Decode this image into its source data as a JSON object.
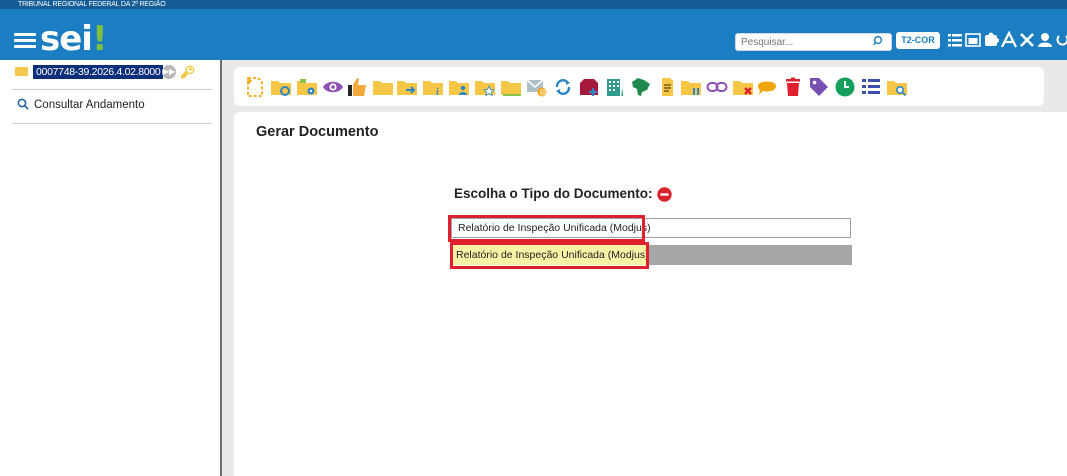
{
  "header": {
    "org_name": "TRIBUNAL REGIONAL FEDERAL DA 2ª REGIÃO",
    "logo_text": "sei",
    "logo_mark": "!",
    "search": {
      "placeholder": "Pesquisar..."
    },
    "unit_badge": "T2-COR",
    "icons": [
      "menu-icon",
      "search-icon",
      "list-icon",
      "calendar-icon",
      "puzzle-icon",
      "font-size-icon",
      "tools-icon",
      "user-icon",
      "power-icon"
    ],
    "colors": {
      "bar": "#1b7ec2",
      "stripe": "#155d94",
      "accent_green": "#7fbf3f"
    }
  },
  "sidebar": {
    "process_number": "0007748-39.2026.4.02.8000",
    "consult_label": "Consultar Andamento"
  },
  "toolbar": {
    "buttons": [
      "new-document",
      "relate-process",
      "attach-process",
      "view-access",
      "set-marker",
      "reply",
      "send-process",
      "sign-block",
      "assign-process",
      "follow-up",
      "schedule",
      "send-email",
      "update-sheet",
      "priority",
      "duplicate-record",
      "recycle",
      "upload-sheet",
      "bookmark",
      "suspend",
      "link",
      "remove-relation",
      "comment",
      "delete",
      "tag",
      "deadline",
      "list-view",
      "search-process"
    ]
  },
  "main": {
    "title": "Gerar Documento",
    "choose_label": "Escolha o Tipo do Documento:",
    "type_input_value": "Relatório de Inspeção Unificada (Modjus)",
    "result_item": "Relatório de Inspeção Unificada (Modjus)",
    "highlight_color": "#e0202c",
    "result_bg": "#f7f3a6"
  }
}
